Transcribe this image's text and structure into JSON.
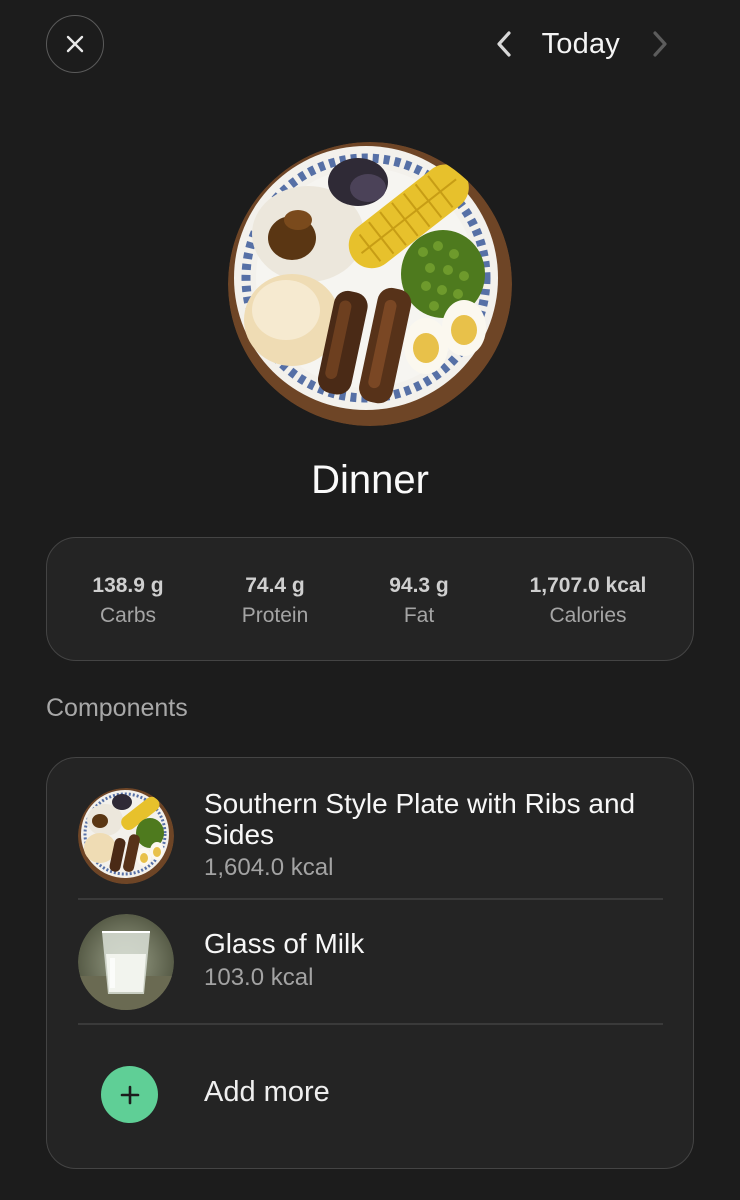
{
  "header": {
    "date_label": "Today",
    "close_icon": "close-icon",
    "prev_icon": "chevron-left-icon",
    "next_icon": "chevron-right-icon"
  },
  "meal": {
    "title": "Dinner",
    "photo_icon": "dinner-plate-photo"
  },
  "macros": [
    {
      "value": "138.9 g",
      "label": "Carbs"
    },
    {
      "value": "74.4 g",
      "label": "Protein"
    },
    {
      "value": "94.3 g",
      "label": "Fat"
    },
    {
      "value": "1,707.0 kcal",
      "label": "Calories"
    }
  ],
  "components": {
    "section_label": "Components",
    "items": [
      {
        "name": "Southern Style Plate with Ribs and Sides",
        "kcal": "1,604.0 kcal"
      },
      {
        "name": "Glass of Milk",
        "kcal": "103.0 kcal"
      }
    ],
    "add_label": "Add more"
  },
  "colors": {
    "background": "#1c1c1c",
    "card": "#242424",
    "accent": "#5fcf96"
  }
}
